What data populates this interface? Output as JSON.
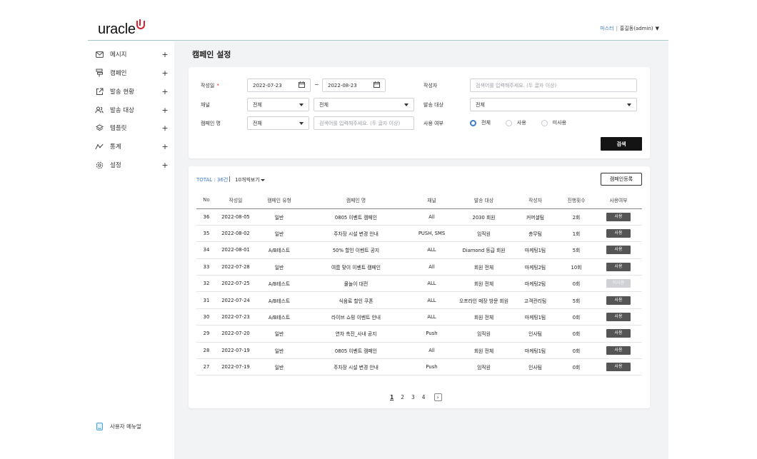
{
  "header": {
    "logo_text": "uracle",
    "master_label": "마스터",
    "user_label": "홍길동(admin)"
  },
  "sidebar": {
    "items": [
      {
        "label": "메시지",
        "icon": "mail-icon"
      },
      {
        "label": "캠페인",
        "icon": "campaign-icon"
      },
      {
        "label": "발송 현황",
        "icon": "external-link-icon"
      },
      {
        "label": "발송 대상",
        "icon": "users-icon"
      },
      {
        "label": "템플릿",
        "icon": "layers-icon"
      },
      {
        "label": "통계",
        "icon": "chart-line-icon"
      },
      {
        "label": "설정",
        "icon": "gear-icon"
      }
    ],
    "manual_label": "사용자 메뉴얼"
  },
  "page": {
    "title": "캠페인 설정"
  },
  "search": {
    "date_label": "작성일",
    "date_required": "*",
    "date_from": "2022-07-23",
    "date_sep": "~",
    "date_to": "2022-08-23",
    "author_label": "작성자",
    "author_placeholder": "검색어를 입력해주세요. (두 글자 이상)",
    "channel_label": "채널",
    "channel_value_1": "전체",
    "channel_value_2": "전체",
    "target_label": "발송 대상",
    "target_value": "전체",
    "campaign_name_label": "캠페인 명",
    "campaign_name_select": "전체",
    "campaign_name_placeholder": "검색어를 입력해주세요. (두 글자 이상)",
    "use_label": "사용 여부",
    "use_options": [
      "전체",
      "사용",
      "미사용"
    ],
    "search_button": "검색"
  },
  "results": {
    "total_label": "TOTAL : 36건",
    "total_sep": "|",
    "per_page": "10개씩보기",
    "register_button": "캠페인등록",
    "columns": [
      "No",
      "작성일",
      "캠페인 유형",
      "캠페인 명",
      "채널",
      "발송 대상",
      "작성자",
      "진행횟수",
      "사용여부"
    ],
    "rows": [
      {
        "no": "36",
        "date": "2022-08-05",
        "type": "일반",
        "name": "0805 이벤트 캠페인",
        "channel": "All",
        "target": "2030 회원",
        "author": "커머셜팀",
        "count": "2회",
        "use": "사용",
        "active": true
      },
      {
        "no": "35",
        "date": "2022-08-02",
        "type": "일반",
        "name": "주차장 시설 변경 안내",
        "channel": "PUSH, SMS",
        "target": "임직원",
        "author": "총무팀",
        "count": "1회",
        "use": "사용",
        "active": true
      },
      {
        "no": "34",
        "date": "2022-08-01",
        "type": "A/B테스트",
        "name": "50% 할인 이벤트 공지",
        "channel": "ALL",
        "target": "Diamond 등급 회원",
        "author": "마케팅1팀",
        "count": "5회",
        "use": "사용",
        "active": true
      },
      {
        "no": "33",
        "date": "2022-07-28",
        "type": "일반",
        "name": "여름 맞이 이벤트 캠페인",
        "channel": "All",
        "target": "회원 전체",
        "author": "마케팅2팀",
        "count": "10회",
        "use": "사용",
        "active": true
      },
      {
        "no": "32",
        "date": "2022-07-25",
        "type": "A/B테스트",
        "name": "물놀이 대전",
        "channel": "ALL",
        "target": "회원 전체",
        "author": "마케팅2팀",
        "count": "0회",
        "use": "미사용",
        "active": false
      },
      {
        "no": "31",
        "date": "2022-07-24",
        "type": "A/B테스트",
        "name": "식음료 할인 쿠폰",
        "channel": "ALL",
        "target": "오프라인 매장 방문 회원",
        "author": "고객관리팀",
        "count": "5회",
        "use": "사용",
        "active": true
      },
      {
        "no": "30",
        "date": "2022-07-23",
        "type": "A/B테스트",
        "name": "라이브 쇼핑 이벤트 안내",
        "channel": "ALL",
        "target": "회원 전체",
        "author": "마케팅1팀",
        "count": "0회",
        "use": "사용",
        "active": true
      },
      {
        "no": "29",
        "date": "2022-07-20",
        "type": "일반",
        "name": "연차 촉진_사내 공지",
        "channel": "Push",
        "target": "임직원",
        "author": "인사팀",
        "count": "0회",
        "use": "사용",
        "active": true
      },
      {
        "no": "28",
        "date": "2022-07-19",
        "type": "일반",
        "name": "0805 이벤트 캠페인",
        "channel": "All",
        "target": "회원 전체",
        "author": "마케팅1팀",
        "count": "0회",
        "use": "사용",
        "active": true
      },
      {
        "no": "27",
        "date": "2022-07-19",
        "type": "일반",
        "name": "주차장 시설 변경 안내",
        "channel": "Push",
        "target": "임직원",
        "author": "인사팀",
        "count": "0회",
        "use": "사용",
        "active": true
      }
    ],
    "pages": [
      "1",
      "2",
      "3",
      "4"
    ],
    "next_glyph": "›"
  },
  "colors": {
    "accent": "#3b7bc9",
    "brand_red": "#d6202a",
    "badge_on": "#555555",
    "badge_off": "#cfd1d4"
  }
}
